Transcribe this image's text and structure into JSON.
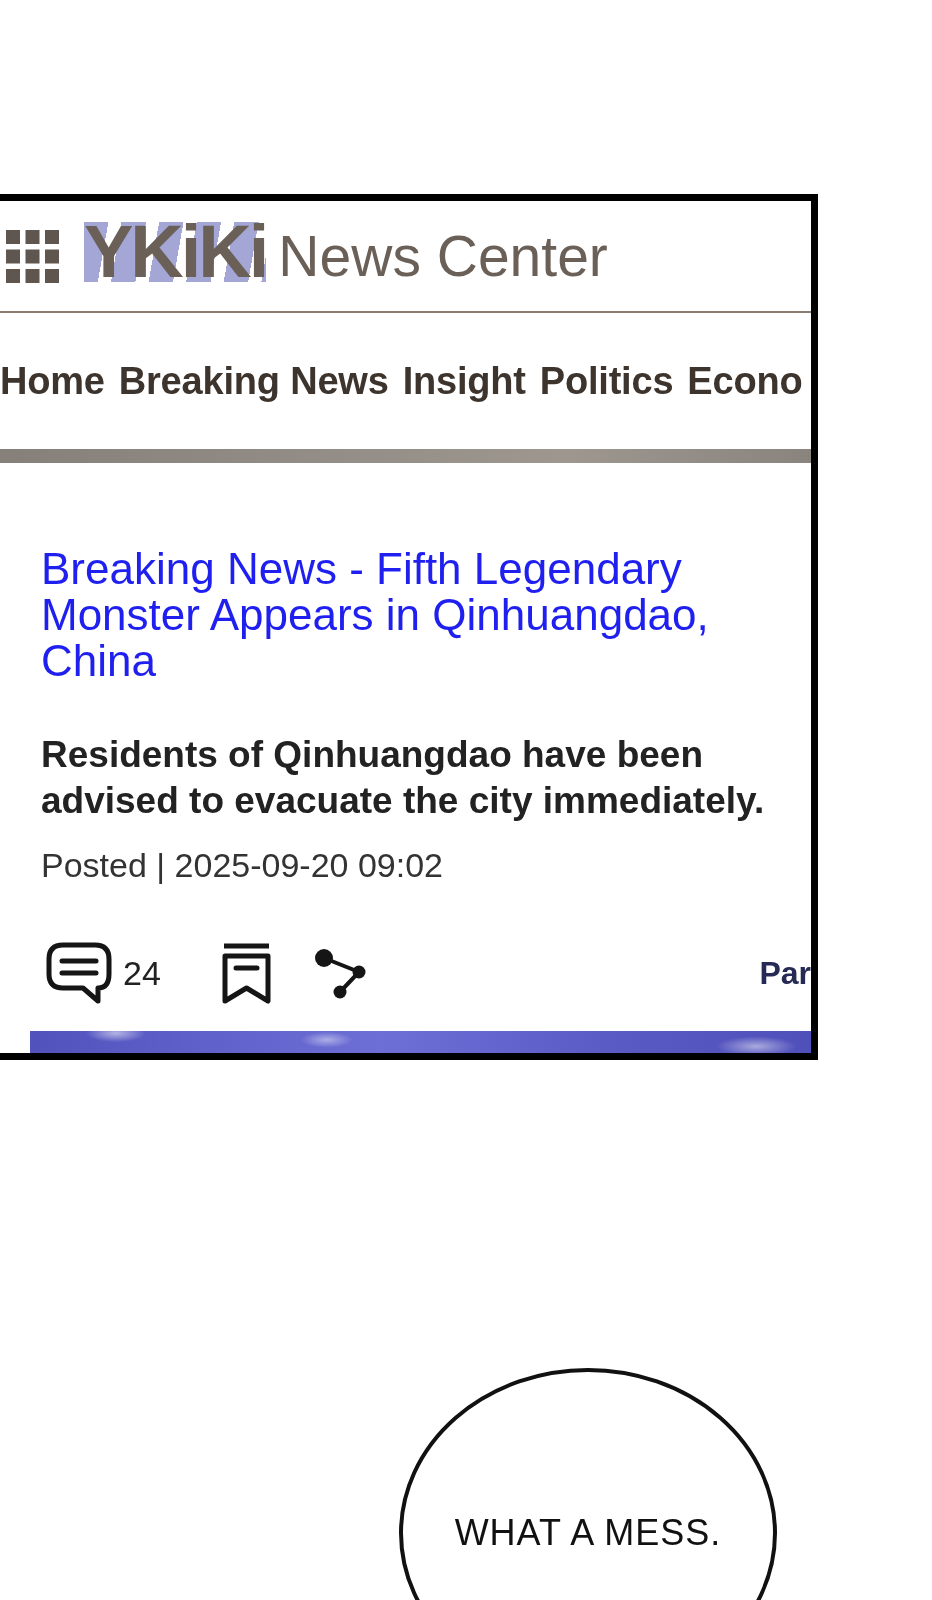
{
  "header": {
    "logo": "YKiKi",
    "site_name": "News Center"
  },
  "nav": {
    "items": [
      "Home",
      "Breaking News",
      "Insight",
      "Politics",
      "Econo"
    ]
  },
  "article": {
    "headline": "Breaking News - Fifth Legendary Monster Appears in Qinhuangdao, China",
    "summary": "Residents of Qinhuangdao have been advised to evacuate the city immediately.",
    "posted": "Posted | 2025-09-20 09:02",
    "comment_count": "24",
    "trailing_link": "Par"
  },
  "speech_bubble": {
    "text": "WHAT A MESS."
  }
}
